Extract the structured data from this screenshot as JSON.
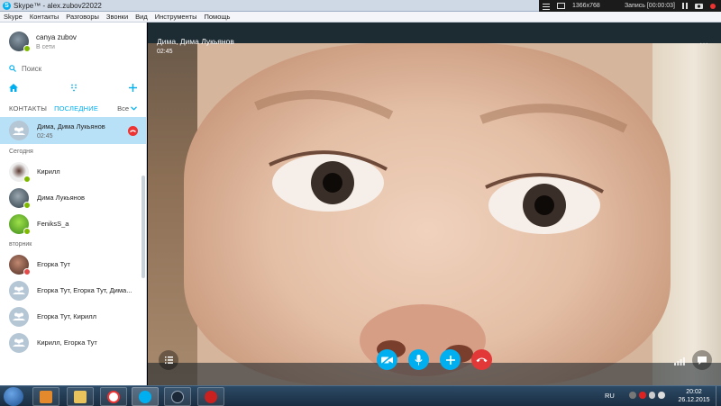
{
  "window": {
    "title": "Skype™ - alex.zubov22022"
  },
  "recorder": {
    "resolution": "1366x768",
    "record_label": "Запись [00:00:03]"
  },
  "menu": [
    "Skype",
    "Контакты",
    "Разговоры",
    "Звонки",
    "Вид",
    "Инструменты",
    "Помощь"
  ],
  "profile": {
    "name": "canya zubov",
    "status": "В сети"
  },
  "search": {
    "placeholder": "Поиск"
  },
  "tabs": {
    "contacts": "КОНТАКТЫ",
    "recent": "ПОСЛЕДНИЕ",
    "filter": "Все"
  },
  "active_conversation": {
    "title": "Дима, Дима Лукьянов",
    "time": "02:45"
  },
  "sections": [
    {
      "label": "Сегодня",
      "items": [
        {
          "name": "Кирилл"
        },
        {
          "name": "Дима Лукьянов"
        },
        {
          "name": "FeniksS_a"
        }
      ]
    },
    {
      "label": "вторник",
      "items": [
        {
          "name": "Егорка Тут"
        },
        {
          "name": "Егорка Тут, Егорка Тут, Дима..."
        },
        {
          "name": "Егорка Тут, Кирилл"
        },
        {
          "name": "Кирилл, Егорка Тут"
        }
      ]
    }
  ],
  "call": {
    "name": "Дима, Дима Лукьянов",
    "duration": "02:45"
  },
  "taskbar": {
    "language": "RU",
    "time": "20:02",
    "date": "26.12.2015"
  },
  "colors": {
    "skype_blue": "#00aff0",
    "hangup_red": "#e33838",
    "online_green": "#7fba00",
    "selected_row": "#b8e0f6"
  }
}
